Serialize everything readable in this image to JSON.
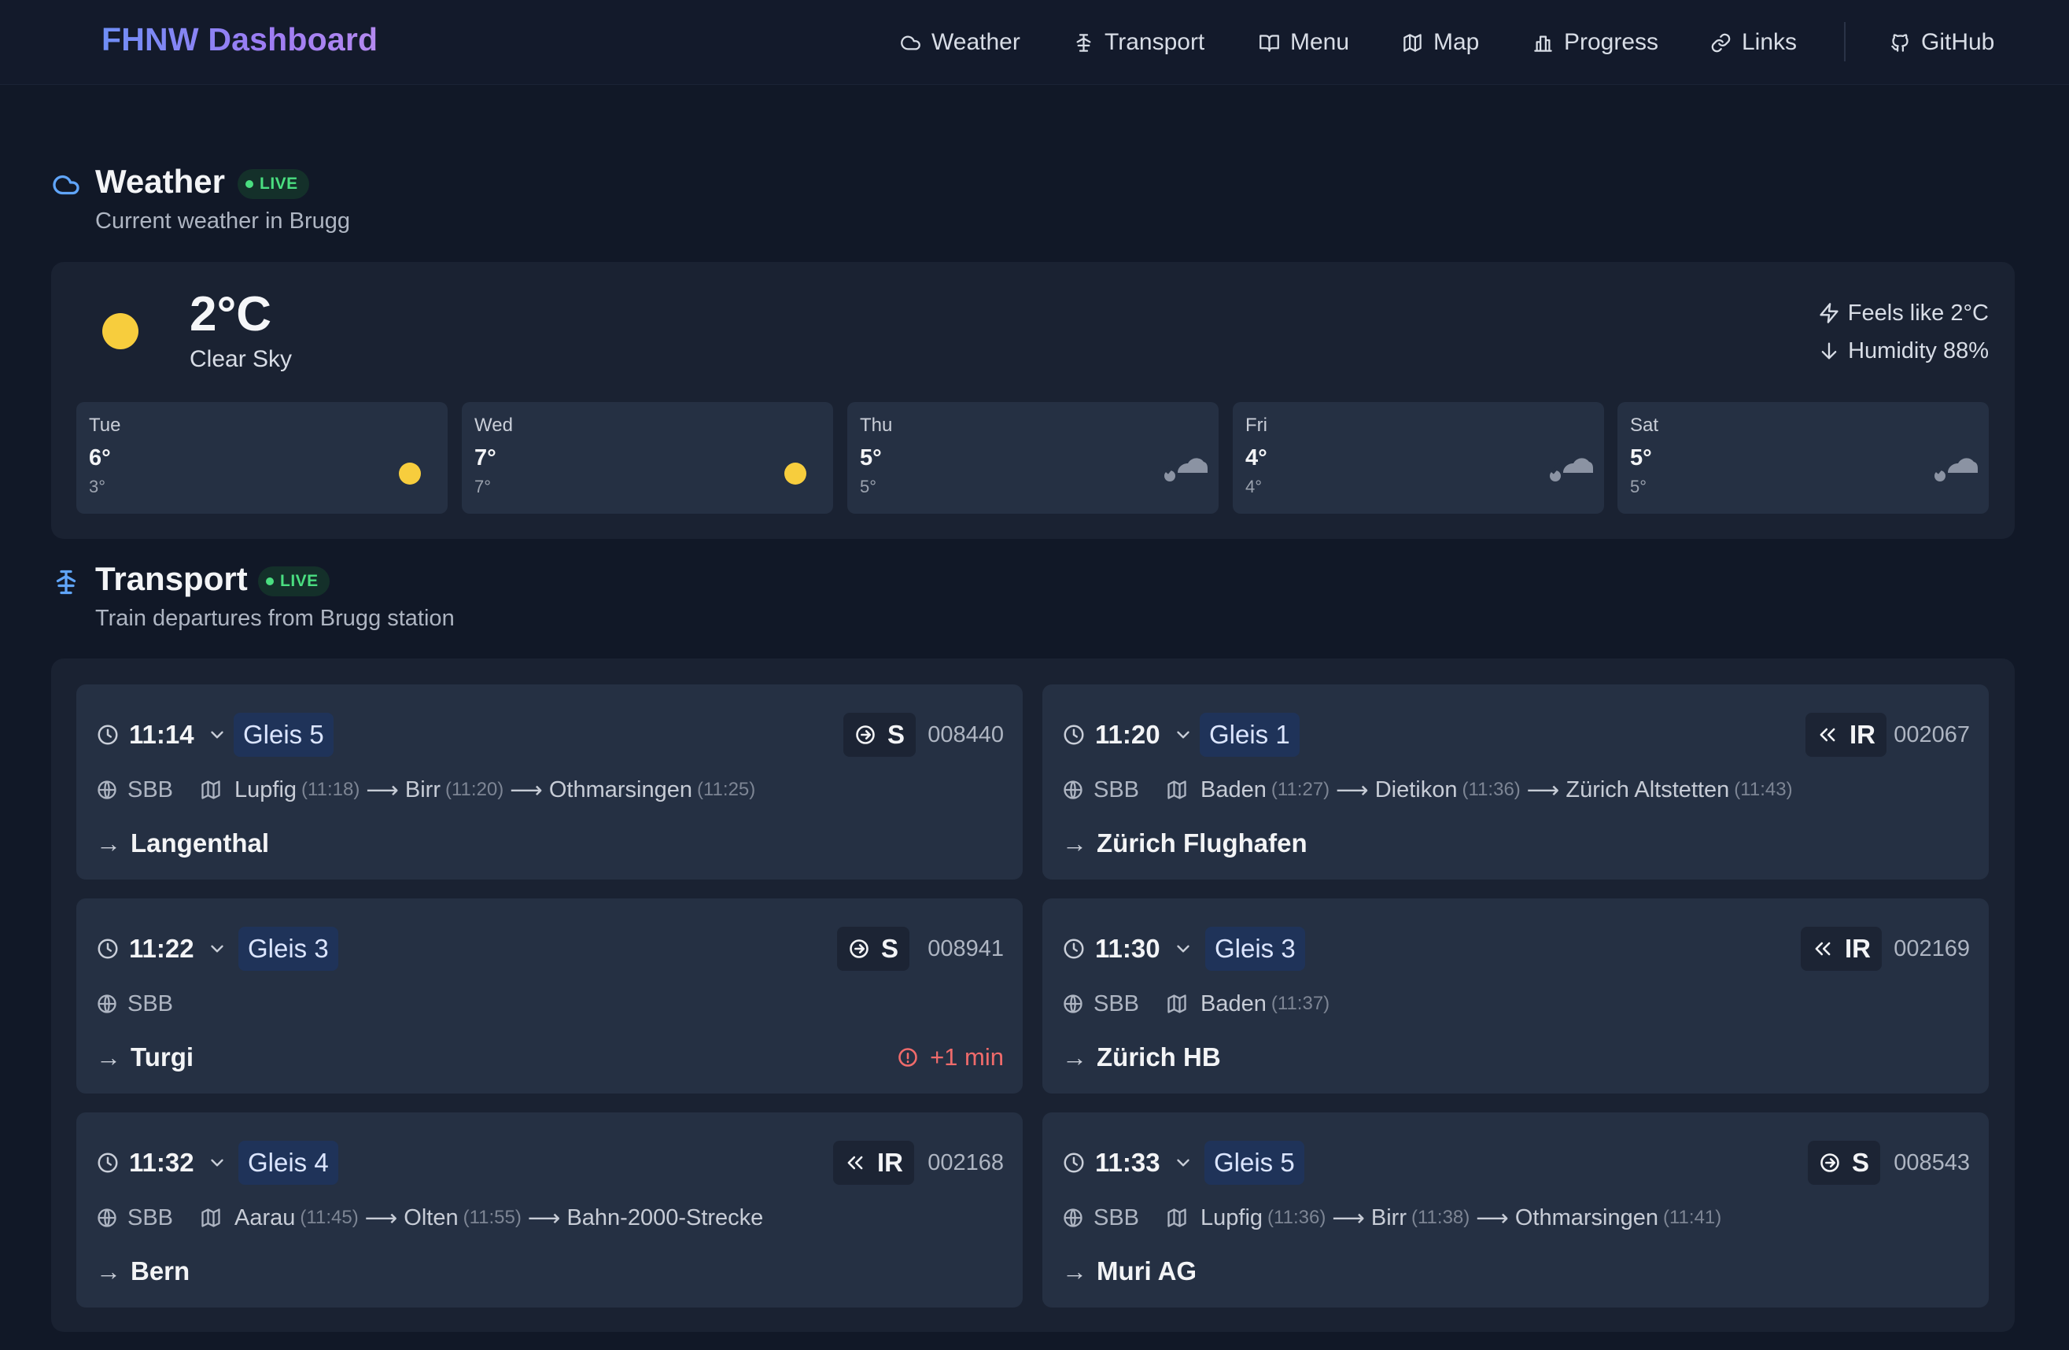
{
  "brand": "FHNW Dashboard",
  "nav": {
    "weather": "Weather",
    "transport": "Transport",
    "menu": "Menu",
    "map": "Map",
    "progress": "Progress",
    "links": "Links",
    "github": "GitHub"
  },
  "weather": {
    "title": "Weather",
    "live": "LIVE",
    "subtitle": "Current weather in Brugg",
    "current": {
      "temp": "2°C",
      "condition": "Clear Sky",
      "icon": "sun-icon"
    },
    "feels_like": "Feels like 2°C",
    "humidity": "Humidity 88%",
    "forecast": [
      {
        "day": "Tue",
        "high": "6°",
        "low": "3°",
        "icon": "sun-icon"
      },
      {
        "day": "Wed",
        "high": "7°",
        "low": "7°",
        "icon": "sun-icon"
      },
      {
        "day": "Thu",
        "high": "5°",
        "low": "5°",
        "icon": "cloud-rain-icon"
      },
      {
        "day": "Fri",
        "high": "4°",
        "low": "4°",
        "icon": "cloud-rain-icon"
      },
      {
        "day": "Sat",
        "high": "5°",
        "low": "5°",
        "icon": "cloud-rain-icon"
      }
    ]
  },
  "transport": {
    "title": "Transport",
    "live": "LIVE",
    "subtitle": "Train departures from Brugg station",
    "departures": [
      {
        "time": "11:14",
        "platform": "Gleis 5",
        "type": "S",
        "number": "008440",
        "operator": "SBB",
        "stops": [
          {
            "name": "Lupfig",
            "time": "(11:18)"
          },
          {
            "name": "Birr",
            "time": "(11:20)"
          },
          {
            "name": "Othmarsingen",
            "time": "(11:25)"
          }
        ],
        "destination": "Langenthal",
        "delay": ""
      },
      {
        "time": "11:20",
        "platform": "Gleis 1",
        "type": "IR",
        "number": "002067",
        "operator": "SBB",
        "stops": [
          {
            "name": "Baden",
            "time": "(11:27)"
          },
          {
            "name": "Dietikon",
            "time": "(11:36)"
          },
          {
            "name": "Zürich Altstetten",
            "time": "(11:43)"
          }
        ],
        "destination": "Zürich Flughafen",
        "delay": ""
      },
      {
        "time": "11:22",
        "platform": "Gleis 3",
        "type": "S",
        "number": "008941",
        "operator": "SBB",
        "stops": [],
        "destination": "Turgi",
        "delay": "+1 min"
      },
      {
        "time": "11:30",
        "platform": "Gleis 3",
        "type": "IR",
        "number": "002169",
        "operator": "SBB",
        "stops": [
          {
            "name": "Baden",
            "time": "(11:37)"
          }
        ],
        "destination": "Zürich HB",
        "delay": ""
      },
      {
        "time": "11:32",
        "platform": "Gleis 4",
        "type": "IR",
        "number": "002168",
        "operator": "SBB",
        "stops": [
          {
            "name": "Aarau",
            "time": "(11:45)"
          },
          {
            "name": "Olten",
            "time": "(11:55)"
          },
          {
            "name": "Bahn-2000-Strecke",
            "time": ""
          }
        ],
        "destination": "Bern",
        "delay": ""
      },
      {
        "time": "11:33",
        "platform": "Gleis 5",
        "type": "S",
        "number": "008543",
        "operator": "SBB",
        "stops": [
          {
            "name": "Lupfig",
            "time": "(11:36)"
          },
          {
            "name": "Birr",
            "time": "(11:38)"
          },
          {
            "name": "Othmarsingen",
            "time": "(11:41)"
          }
        ],
        "destination": "Muri AG",
        "delay": ""
      }
    ]
  },
  "colors": {
    "accent": "#60a5fa",
    "live": "#4ade80",
    "delay": "#f06b6b",
    "sun": "#f7cd3d"
  }
}
